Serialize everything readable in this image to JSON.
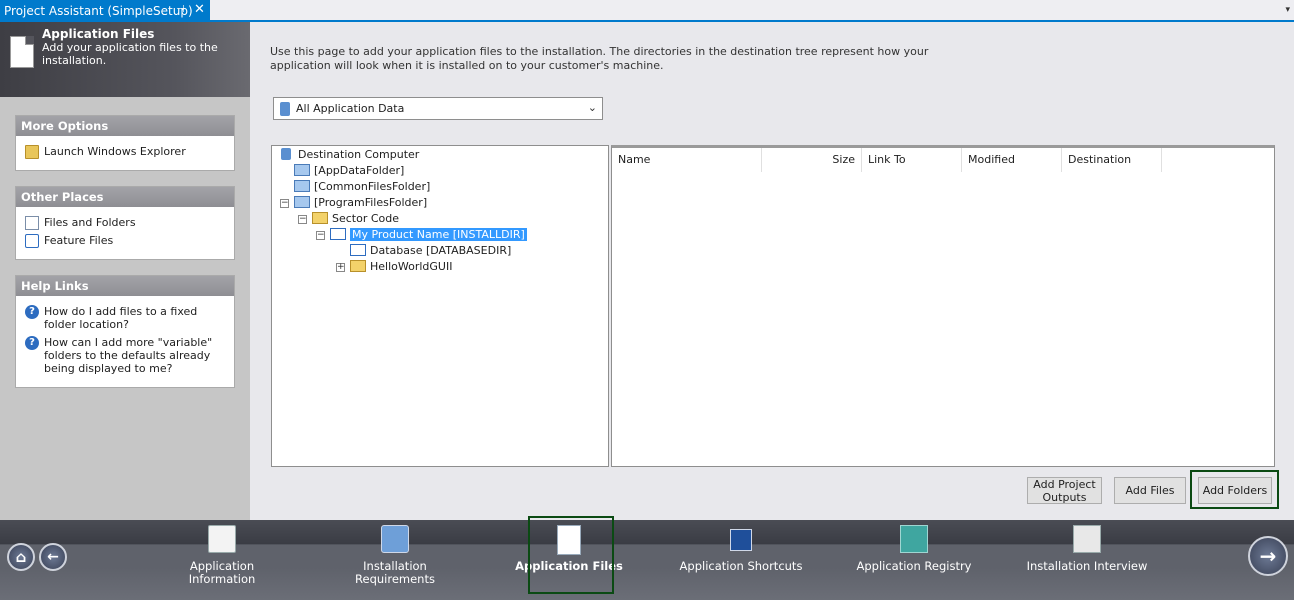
{
  "tab": {
    "title": "Project Assistant (SimpleSetup)",
    "pin": "⊣",
    "close": "✕",
    "dropdown": "▾"
  },
  "header": {
    "title": "Application Files",
    "subtitle": "Add your application files to the installation."
  },
  "more_options": {
    "title": "More Options",
    "items": [
      {
        "label": "Launch Windows Explorer",
        "icon": "folder-icon"
      }
    ]
  },
  "other_places": {
    "title": "Other Places",
    "items": [
      {
        "label": "Files and Folders",
        "icon": "file-icon"
      },
      {
        "label": "Feature Files",
        "icon": "feature-icon"
      }
    ]
  },
  "help_links": {
    "title": "Help Links",
    "items": [
      {
        "label": "How do I add files to a fixed folder location?"
      },
      {
        "label": "How can I add more \"variable\" folders to the defaults already being displayed to me?"
      }
    ]
  },
  "main": {
    "intro": "Use this page to add your application files to the installation. The directories in the destination tree represent how your application will look when it is installed on to your customer's machine.",
    "combo_value": "All Application Data",
    "tree": {
      "root": "Destination Computer",
      "app_data": "[AppDataFolder]",
      "common_files": "[CommonFilesFolder]",
      "program_files": "[ProgramFilesFolder]",
      "sector_code": "Sector Code",
      "product": "My Product Name [INSTALLDIR]",
      "database": "Database [DATABASEDIR]",
      "hello": "HelloWorldGUII"
    },
    "columns": [
      "Name",
      "Size",
      "Link To",
      "Modified",
      "Destination"
    ],
    "buttons": {
      "add_project_outputs": "Add Project Outputs",
      "add_files": "Add Files",
      "add_folders": "Add Folders"
    }
  },
  "nav": {
    "items": [
      {
        "label": "Application Information"
      },
      {
        "label": "Installation Requirements"
      },
      {
        "label": "Application Files"
      },
      {
        "label": "Application Shortcuts"
      },
      {
        "label": "Application Registry"
      },
      {
        "label": "Installation Interview"
      }
    ],
    "home_icon": "⌂",
    "back_icon": "←",
    "next_icon": "→"
  }
}
